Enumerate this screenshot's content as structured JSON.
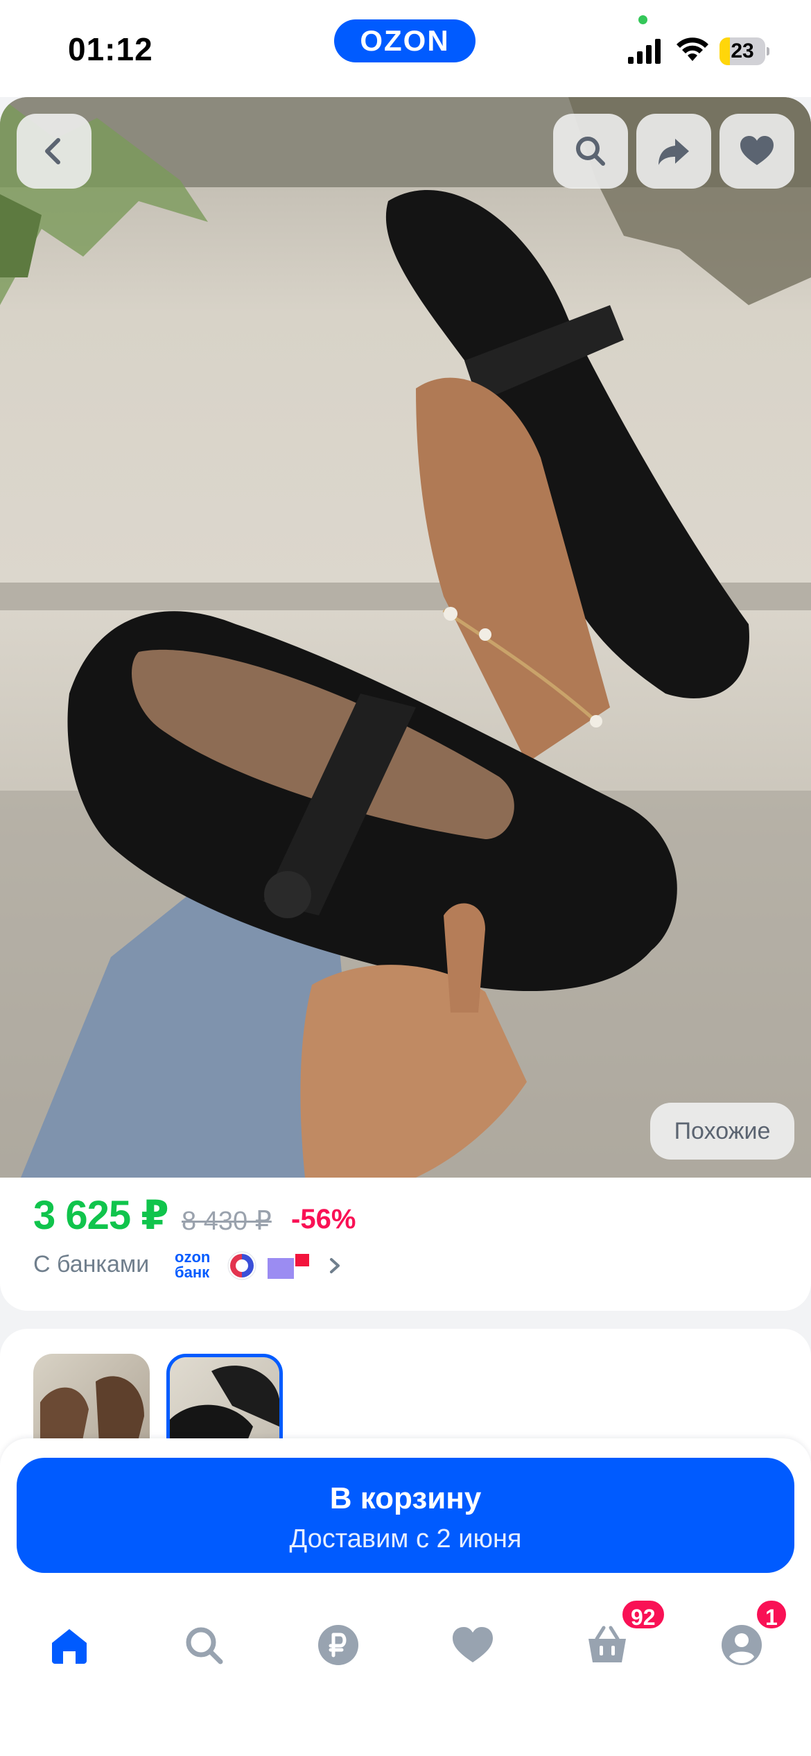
{
  "status_bar": {
    "time": "01:12",
    "brand": "OZON",
    "battery": "23",
    "battery_level": 0.23,
    "signal_icon": "cellular-signal-icon",
    "wifi_icon": "wifi-icon"
  },
  "colors": {
    "accent": "#005bff",
    "price": "#10c44c",
    "discount": "#f91155",
    "badge": "#f91155"
  },
  "gallery": {
    "back_icon": "chevron-left-icon",
    "actions": [
      "search-icon",
      "share-icon",
      "heart-icon"
    ],
    "similar_label": "Похожие"
  },
  "price": {
    "current": "3 625 ₽",
    "old": "8 430 ₽",
    "discount": "-56%",
    "banks_label": "С банками",
    "ozon_bank_line1": "ozon",
    "ozon_bank_line2": "банк"
  },
  "variants": {
    "selected_index": 1,
    "items": [
      "variant-brown",
      "variant-black"
    ]
  },
  "cart": {
    "button_label": "В корзину",
    "delivery_label": "Доставим с 2 июня"
  },
  "nav": {
    "items": [
      {
        "icon": "home-icon",
        "active": true
      },
      {
        "icon": "search-icon",
        "active": false
      },
      {
        "icon": "ruble-icon",
        "active": false
      },
      {
        "icon": "heart-icon",
        "active": false
      },
      {
        "icon": "cart-icon",
        "active": false,
        "badge": "92"
      },
      {
        "icon": "profile-icon",
        "active": false,
        "badge": "1"
      }
    ]
  }
}
